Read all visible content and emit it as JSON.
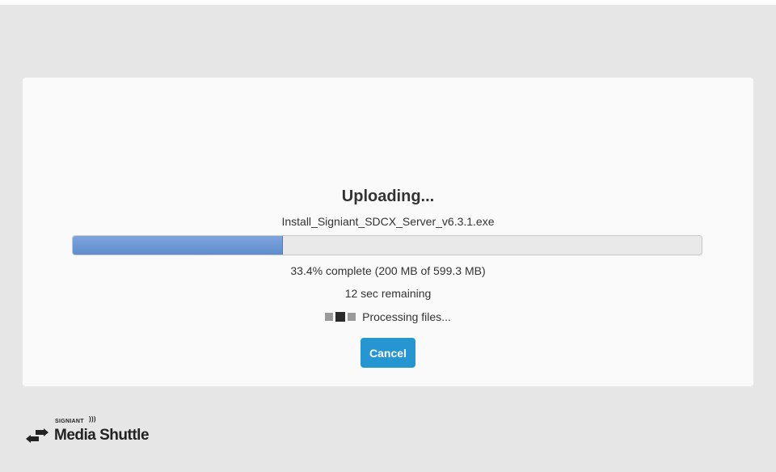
{
  "upload": {
    "title": "Uploading...",
    "filename": "Install_Signiant_SDCX_Server_v6.3.1.exe",
    "progress_fraction": 0.334,
    "status": "33.4% complete (200 MB of 599.3 MB)",
    "remaining": "12 sec remaining",
    "processing": "Processing files...",
    "cancel_label": "Cancel"
  },
  "brand": {
    "company": "SIGNIANT",
    "product": "Media Shuttle",
    "icon": "swap-arrows-icon"
  },
  "colors": {
    "accent": "#2596d2",
    "progress_fill": "#6a95d4",
    "background": "#e6e6e6",
    "card": "#fafafa"
  }
}
